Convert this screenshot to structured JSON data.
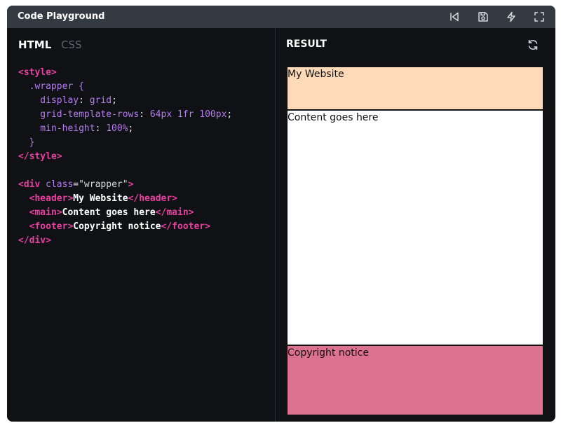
{
  "window": {
    "title": "Code Playground"
  },
  "toolbar": {
    "icons": [
      "reset-icon",
      "save-icon",
      "lightning-icon",
      "fullscreen-icon"
    ]
  },
  "editor": {
    "tabs": [
      {
        "label": "HTML",
        "active": true
      },
      {
        "label": "CSS",
        "active": false
      }
    ],
    "code": {
      "l1_tag": "<style>",
      "l2_sel": "  .wrapper {",
      "l3_prop": "    display",
      "l3_punct": ": ",
      "l3_val": "grid",
      "l3_end": ";",
      "l4_prop": "    grid-template-rows",
      "l4_punct": ": ",
      "l4_val": "64px 1fr 100px",
      "l4_end": ";",
      "l5_prop": "    min-height",
      "l5_punct": ": ",
      "l5_val": "100%",
      "l5_end": ";",
      "l6_sel": "  }",
      "l7_tag": "</style>",
      "l9_open": "<div ",
      "l9_attr": "class",
      "l9_eq": "=",
      "l9_str": "\"wrapper\"",
      "l9_close": ">",
      "l10_indent": "  ",
      "l10_open": "<header>",
      "l10_text": "My Website",
      "l10_close": "</header>",
      "l11_indent": "  ",
      "l11_open": "<main>",
      "l11_text": "Content goes here",
      "l11_close": "</main>",
      "l12_indent": "  ",
      "l12_open": "<footer>",
      "l12_text": "Copyright notice",
      "l12_close": "</footer>",
      "l13_tag": "</div>"
    }
  },
  "result": {
    "title": "RESULT",
    "header_text": "My Website",
    "main_text": "Content goes here",
    "footer_text": "Copyright notice",
    "colors": {
      "header_bg": "#ffdab9",
      "footer_bg": "#dc7290"
    }
  },
  "colors": {
    "window_bg": "#0f1115",
    "titlebar_bg": "#343a42",
    "tag": "#e63fa0",
    "keyword": "#b57cf0"
  }
}
